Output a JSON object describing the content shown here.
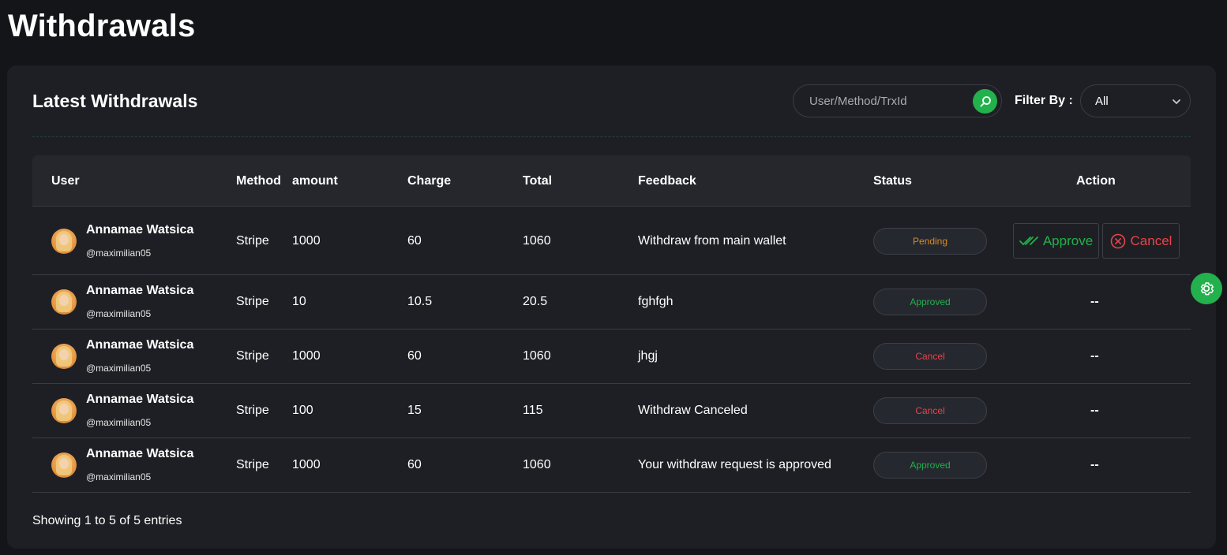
{
  "page": {
    "title": "Withdrawals"
  },
  "card": {
    "title": "Latest Withdrawals",
    "search": {
      "placeholder": "User/Method/TrxId",
      "value": ""
    },
    "filter": {
      "label": "Filter By :",
      "selected": "All"
    }
  },
  "table": {
    "headers": {
      "user": "User",
      "method": "Method",
      "amount": "amount",
      "charge": "Charge",
      "total": "Total",
      "feedback": "Feedback",
      "status": "Status",
      "action": "Action"
    },
    "rows": [
      {
        "name": "Annamae Watsica",
        "handle": "@maximilian05",
        "method": "Stripe",
        "amount": "1000",
        "charge": "60",
        "total": "1060",
        "feedback": "Withdraw from main wallet",
        "status": "Pending",
        "status_kind": "pending",
        "action": ""
      },
      {
        "name": "Annamae Watsica",
        "handle": "@maximilian05",
        "method": "Stripe",
        "amount": "10",
        "charge": "10.5",
        "total": "20.5",
        "feedback": "fghfgh",
        "status": "Approved",
        "status_kind": "approved",
        "action": "--"
      },
      {
        "name": "Annamae Watsica",
        "handle": "@maximilian05",
        "method": "Stripe",
        "amount": "1000",
        "charge": "60",
        "total": "1060",
        "feedback": "jhgj",
        "status": "Cancel",
        "status_kind": "cancel",
        "action": "--"
      },
      {
        "name": "Annamae Watsica",
        "handle": "@maximilian05",
        "method": "Stripe",
        "amount": "100",
        "charge": "15",
        "total": "115",
        "feedback": "Withdraw Canceled",
        "status": "Cancel",
        "status_kind": "cancel",
        "action": "--"
      },
      {
        "name": "Annamae Watsica",
        "handle": "@maximilian05",
        "method": "Stripe",
        "amount": "1000",
        "charge": "60",
        "total": "1060",
        "feedback": "Your withdraw request is approved",
        "status": "Approved",
        "status_kind": "approved",
        "action": "--"
      }
    ],
    "actions": {
      "approve_label": "Approve",
      "cancel_label": "Cancel"
    }
  },
  "footer": {
    "entries_text": "Showing 1 to 5 of 5 entries"
  },
  "icons": {
    "search": "search-icon",
    "chevron": "chevron-down-icon",
    "approve": "double-check-icon",
    "cancel": "x-circle-icon",
    "settings": "gear-icon"
  },
  "colors": {
    "accent": "#22b14c",
    "pending": "#d98b2b",
    "danger": "#e8434a",
    "background": "#141519",
    "card": "#1e1f24"
  }
}
